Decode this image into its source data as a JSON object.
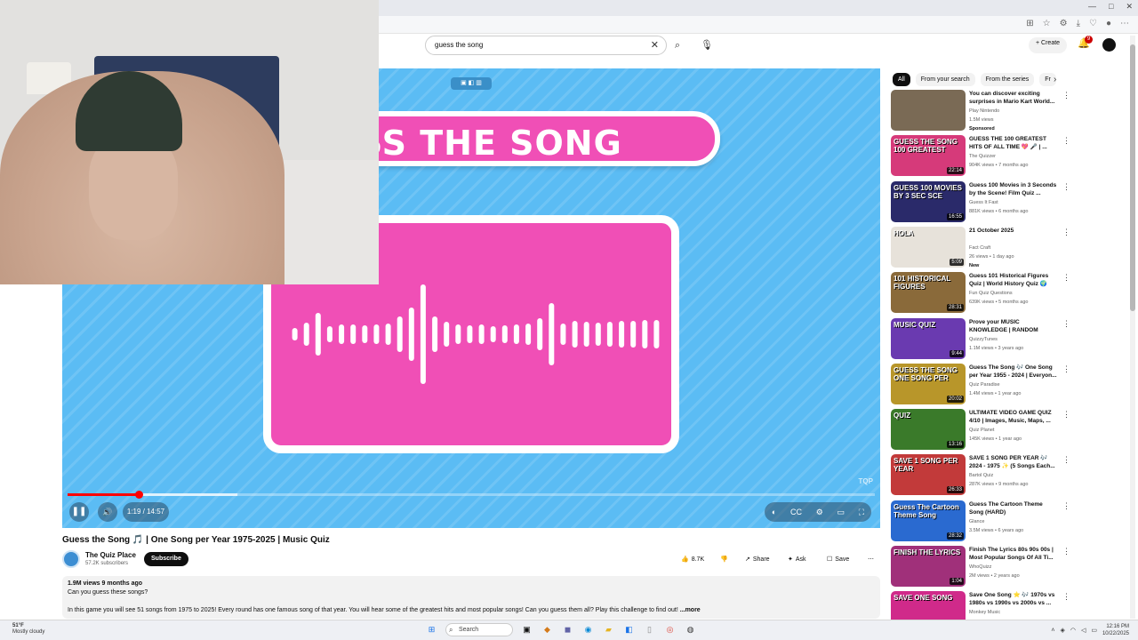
{
  "browser": {
    "window_controls": [
      "—",
      "□",
      "✕"
    ]
  },
  "header": {
    "search_value": "guess the song",
    "create_label": "Create",
    "notification_count": "9"
  },
  "player": {
    "banner_text": "ESS THE SONG",
    "time": "1:19 / 14:57",
    "progress_fraction": 0.088,
    "buffered_fraction": 0.21
  },
  "video": {
    "title": "Guess the Song 🎵 | One Song per Year 1975-2025 | Music Quiz",
    "channel": "The Quiz Place",
    "subscribers": "57.2K subscribers",
    "subscribe_label": "Subscribe",
    "likes": "8.7K",
    "share_label": "Share",
    "ask_label": "Ask",
    "save_label": "Save",
    "desc_meta": "1.9M views  9 months ago",
    "desc_line1": "Can you guess these songs?",
    "desc_line2": "In this game you will see 51 songs from 1975 to 2025! Every round has one famous song of that year. You will hear some of the greatest hits and most popular songs! Can you guess them all? Play this challenge to find out!",
    "more_label": "...more"
  },
  "sidebar": {
    "chips": [
      "All",
      "From your search",
      "From the series",
      "Fr"
    ],
    "items": [
      {
        "title": "You can discover exciting surprises in Mario Kart World...",
        "channel": "Play Nintendo",
        "meta": "1.5M views",
        "badge": "Sponsored",
        "duration": "",
        "thumb_text": "",
        "thumb_color": "#7a6a55"
      },
      {
        "title": "GUESS THE 100 GREATEST HITS OF ALL TIME 💖 🎤 | ...",
        "channel": "The Quizzer",
        "meta": "904K views • 7 months ago",
        "badge": "",
        "duration": "22:14",
        "thumb_text": "GUESS THE SONG 100 GREATEST",
        "thumb_color": "#d63a7a"
      },
      {
        "title": "Guess 100 Movies in 3 Seconds by the Scene! Film Quiz ...",
        "channel": "Guess It Fast",
        "meta": "881K views • 6 months ago",
        "badge": "",
        "duration": "16:55",
        "thumb_text": "GUESS 100 MOVIES BY 3 SEC SCE",
        "thumb_color": "#2a2a6a"
      },
      {
        "title": "21 October 2025",
        "channel": "Fact Craft",
        "meta": "26 views • 1 day ago",
        "badge": "New",
        "duration": "5:09",
        "thumb_text": "HOLA",
        "thumb_color": "#e7e2da"
      },
      {
        "title": "Guess 101 Historical Figures Quiz | World History Quiz 🌍",
        "channel": "Fun Quiz Questions",
        "meta": "639K views • 5 months ago",
        "badge": "",
        "duration": "28:31",
        "thumb_text": "101 HISTORICAL FIGURES",
        "thumb_color": "#8a6a3a"
      },
      {
        "title": "Prove your MUSIC KNOWLEDGE | RANDOM MUSIC QUIZ | GUE...",
        "channel": "QuizzyTunes",
        "meta": "1.1M views • 3 years ago",
        "badge": "",
        "duration": "9:44",
        "thumb_text": "MUSIC QUIZ",
        "thumb_color": "#6a3ab0"
      },
      {
        "title": "Guess The Song 🎶 One Song per Year 1955 - 2024 | Everyon...",
        "channel": "Quiz Paradise",
        "meta": "1.4M views • 1 year ago",
        "badge": "",
        "duration": "20:02",
        "thumb_text": "GUESS THE SONG ONE SONG PER",
        "thumb_color": "#b8962a"
      },
      {
        "title": "ULTIMATE VIDEO GAME QUIZ 4/10 | Images, Music, Maps, ...",
        "channel": "Quiz Planet",
        "meta": "145K views • 1 year ago",
        "badge": "",
        "duration": "13:16",
        "thumb_text": "QUIZ",
        "thumb_color": "#3a7a2a"
      },
      {
        "title": "SAVE 1 SONG PER YEAR 🎶 2024 - 1975 ✨ (5 Songs Each...",
        "channel": "Bartol Quiz",
        "meta": "287K views • 9 months ago",
        "badge": "",
        "duration": "26:33",
        "thumb_text": "SAVE 1 SONG PER YEAR",
        "thumb_color": "#c23a3a"
      },
      {
        "title": "Guess The Cartoon Theme Song (HARD)",
        "channel": "Glance",
        "meta": "3.5M views • 6 years ago",
        "badge": "",
        "duration": "28:32",
        "thumb_text": "Guess The Cartoon Theme Song",
        "thumb_color": "#2a6ad0"
      },
      {
        "title": "Finish The Lyrics 80s 90s 00s | Most Popular Songs Of All Ti...",
        "channel": "WhoQuizz",
        "meta": "2M views • 2 years ago",
        "badge": "",
        "duration": "1:04",
        "thumb_text": "FINISH THE LYRICS",
        "thumb_color": "#a0307a"
      },
      {
        "title": "Save One Song ⭐ 🎶 1970s vs 1980s vs 1990s vs 2000s vs ...",
        "channel": "Monkey Music",
        "meta": "",
        "badge": "",
        "duration": "",
        "thumb_text": "SAVE ONE SONG",
        "thumb_color": "#d02a8a"
      }
    ]
  },
  "taskbar": {
    "weather_temp": "51°F",
    "weather_desc": "Mostly cloudy",
    "search_label": "Search",
    "time": "12:16 PM",
    "date": "10/22/2025"
  }
}
